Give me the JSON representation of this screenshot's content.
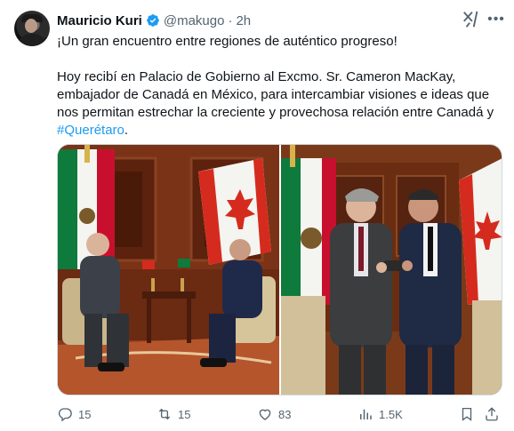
{
  "author": {
    "name": "Mauricio Kuri",
    "handle": "@makugo",
    "separator": "·",
    "time": "2h"
  },
  "tweet": {
    "line1": "¡Un gran encuentro entre regiones de auténtico progreso!",
    "line2": "Hoy recibí en Palacio de Gobierno al Excmo. Sr. Cameron MacKay, embajador de Canadá en México, para intercambiar visiones e ideas que nos permitan estrechar la creciente y provechosa relación entre Canadá y ",
    "hashtag": "#Querétaro",
    "end": "."
  },
  "actions": {
    "replies": "15",
    "reposts": "15",
    "likes": "83",
    "views": "1.5K"
  },
  "icons": {
    "verified": "verified-badge-icon",
    "grok": "grok-icon",
    "more": "more-options-icon",
    "reply": "reply-icon",
    "repost": "repost-icon",
    "like": "like-icon",
    "views": "views-icon",
    "bookmark": "bookmark-icon",
    "share": "share-icon"
  },
  "colors": {
    "accent": "#1d9bf0",
    "text_primary": "#0f1419",
    "text_secondary": "#536471"
  }
}
